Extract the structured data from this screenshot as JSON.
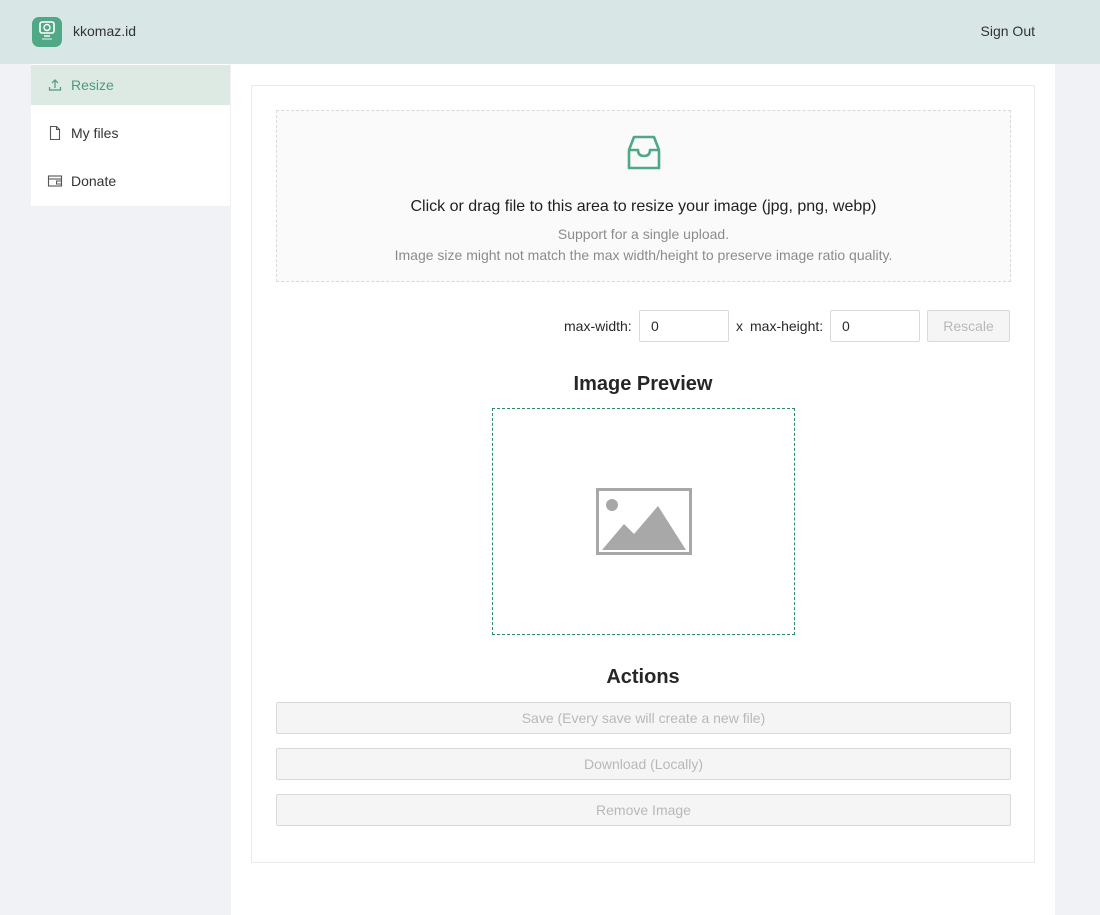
{
  "header": {
    "brand": "kkomaz.id",
    "sign_out": "Sign Out"
  },
  "sidebar": {
    "items": [
      {
        "label": "Resize",
        "icon": "upload-icon",
        "active": true
      },
      {
        "label": "My files",
        "icon": "file-icon",
        "active": false
      },
      {
        "label": "Donate",
        "icon": "wallet-icon",
        "active": false
      }
    ]
  },
  "upload": {
    "title": "Click or drag file to this area to resize your image (jpg, png, webp)",
    "hint_1": "Support for a single upload.",
    "hint_2": "Image size might not match the max width/height to preserve image ratio quality."
  },
  "resize": {
    "max_width_label": "max-width:",
    "max_width_value": "0",
    "separator": "x",
    "max_height_label": "max-height:",
    "max_height_value": "0",
    "rescale_label": "Rescale"
  },
  "preview": {
    "title": "Image Preview"
  },
  "actions": {
    "title": "Actions",
    "save_label": "Save (Every save will create a new file)",
    "download_label": "Download (Locally)",
    "remove_label": "Remove Image"
  },
  "colors": {
    "accent": "#4b9d7a",
    "header_bg": "#d8e6e5",
    "active_item_bg": "#dde9e3"
  }
}
